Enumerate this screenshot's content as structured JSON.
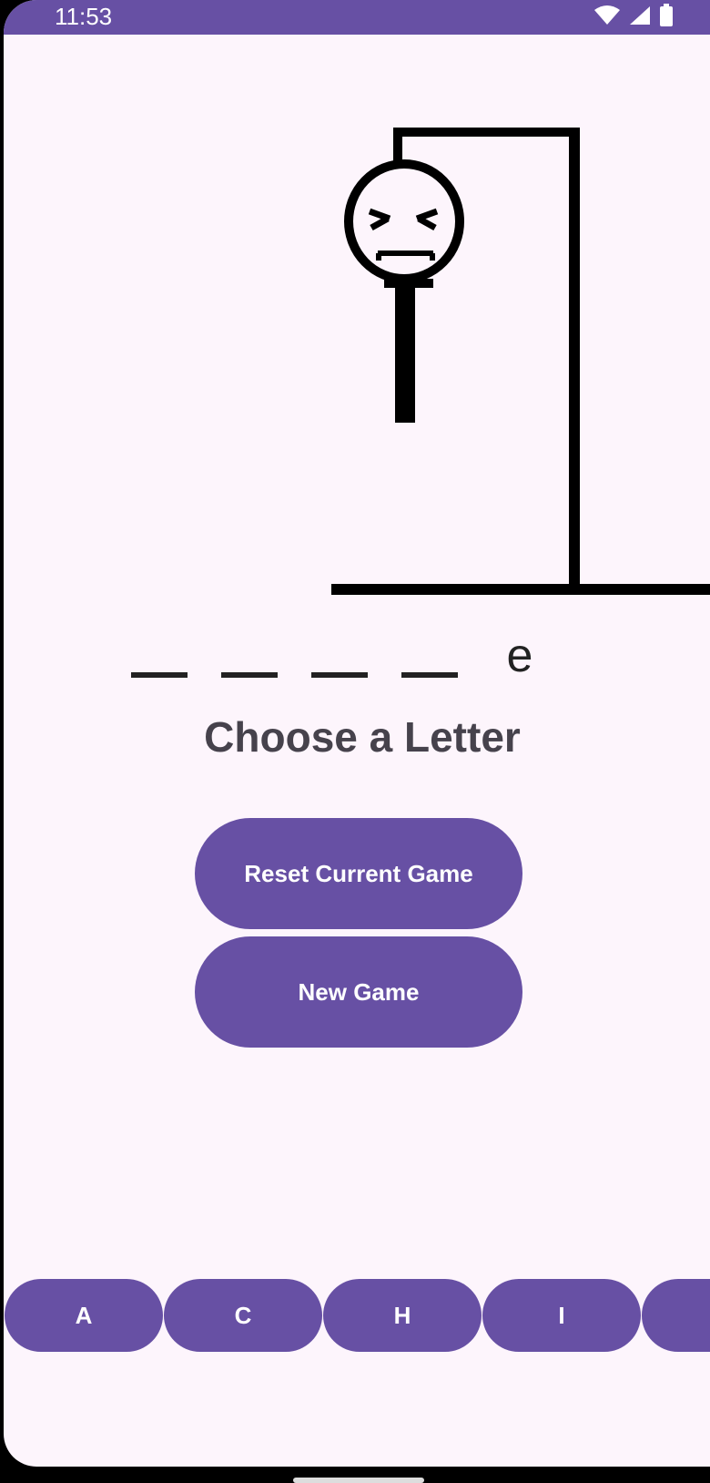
{
  "status_bar": {
    "time": "11:53"
  },
  "game": {
    "word_slots": [
      "",
      "",
      "",
      "",
      "e"
    ],
    "prompt": "Choose a Letter"
  },
  "buttons": {
    "reset_label": "Reset Current Game",
    "new_game_label": "New Game"
  },
  "letters": [
    "A",
    "C",
    "H",
    "I",
    ""
  ],
  "colors": {
    "accent": "#6750a4",
    "background": "#fdf5fc",
    "ink": "#000000"
  }
}
